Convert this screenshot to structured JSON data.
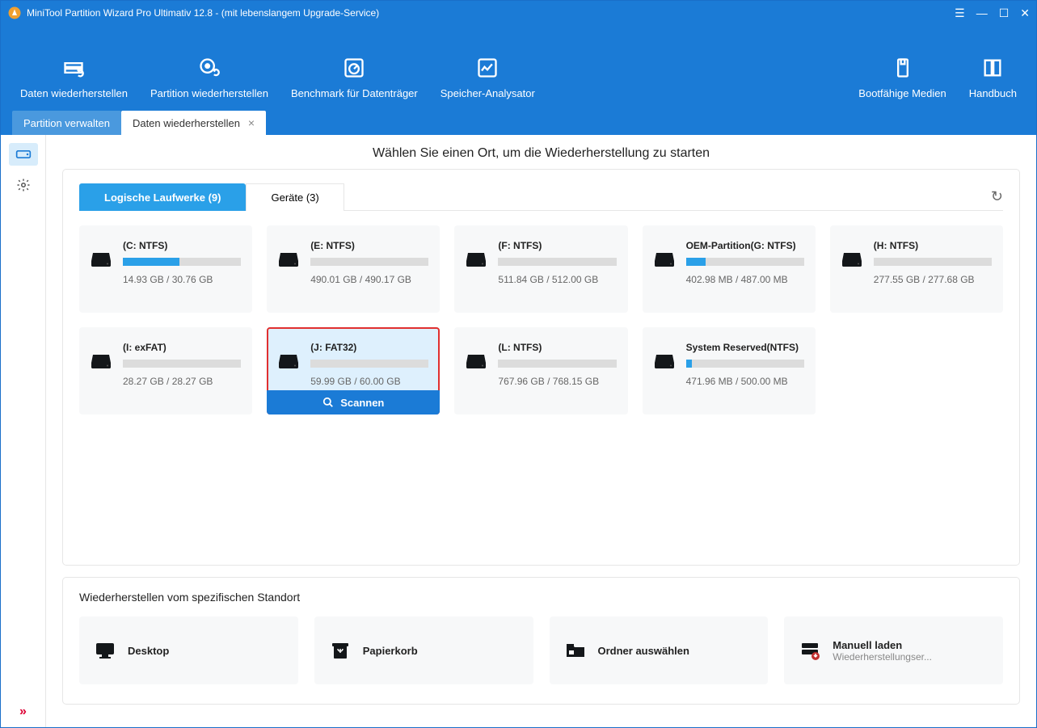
{
  "window": {
    "title": "MiniTool Partition Wizard Pro Ultimativ 12.8 - (mit lebenslangem Upgrade-Service)"
  },
  "toolbar": {
    "data_recover": "Daten wiederherstellen",
    "partition_recover": "Partition wiederherstellen",
    "disk_benchmark": "Benchmark für Datenträger",
    "space_analyzer": "Speicher-Analysator",
    "bootable_media": "Bootfähige Medien",
    "handbook": "Handbuch"
  },
  "tabs": {
    "manage": "Partition verwalten",
    "recover": "Daten wiederherstellen"
  },
  "heading": "Wählen Sie einen Ort, um die Wiederherstellung zu starten",
  "sub_tabs": {
    "logical": "Logische Laufwerke (9)",
    "devices": "Geräte (3)"
  },
  "drives": [
    {
      "name": "(C: NTFS)",
      "size": "14.93 GB / 30.76 GB",
      "fill": 48
    },
    {
      "name": "(E: NTFS)",
      "size": "490.01 GB / 490.17 GB",
      "fill": 0
    },
    {
      "name": "(F: NTFS)",
      "size": "511.84 GB / 512.00 GB",
      "fill": 0
    },
    {
      "name": "OEM-Partition(G: NTFS)",
      "size": "402.98 MB / 487.00 MB",
      "fill": 17
    },
    {
      "name": "(H: NTFS)",
      "size": "277.55 GB / 277.68 GB",
      "fill": 0
    },
    {
      "name": "(I: exFAT)",
      "size": "28.27 GB / 28.27 GB",
      "fill": 0
    },
    {
      "name": "(J: FAT32)",
      "size": "59.99 GB / 60.00 GB",
      "fill": 0,
      "selected": true
    },
    {
      "name": "(L: NTFS)",
      "size": "767.96 GB / 768.15 GB",
      "fill": 0
    },
    {
      "name": "System Reserved(NTFS)",
      "size": "471.96 MB / 500.00 MB",
      "fill": 5
    }
  ],
  "scan_label": "Scannen",
  "locations_title": "Wiederherstellen vom spezifischen Standort",
  "locations": [
    {
      "name": "Desktop",
      "sub": ""
    },
    {
      "name": "Papierkorb",
      "sub": ""
    },
    {
      "name": "Ordner auswählen",
      "sub": ""
    },
    {
      "name": "Manuell laden",
      "sub": "Wiederherstellungser..."
    }
  ]
}
